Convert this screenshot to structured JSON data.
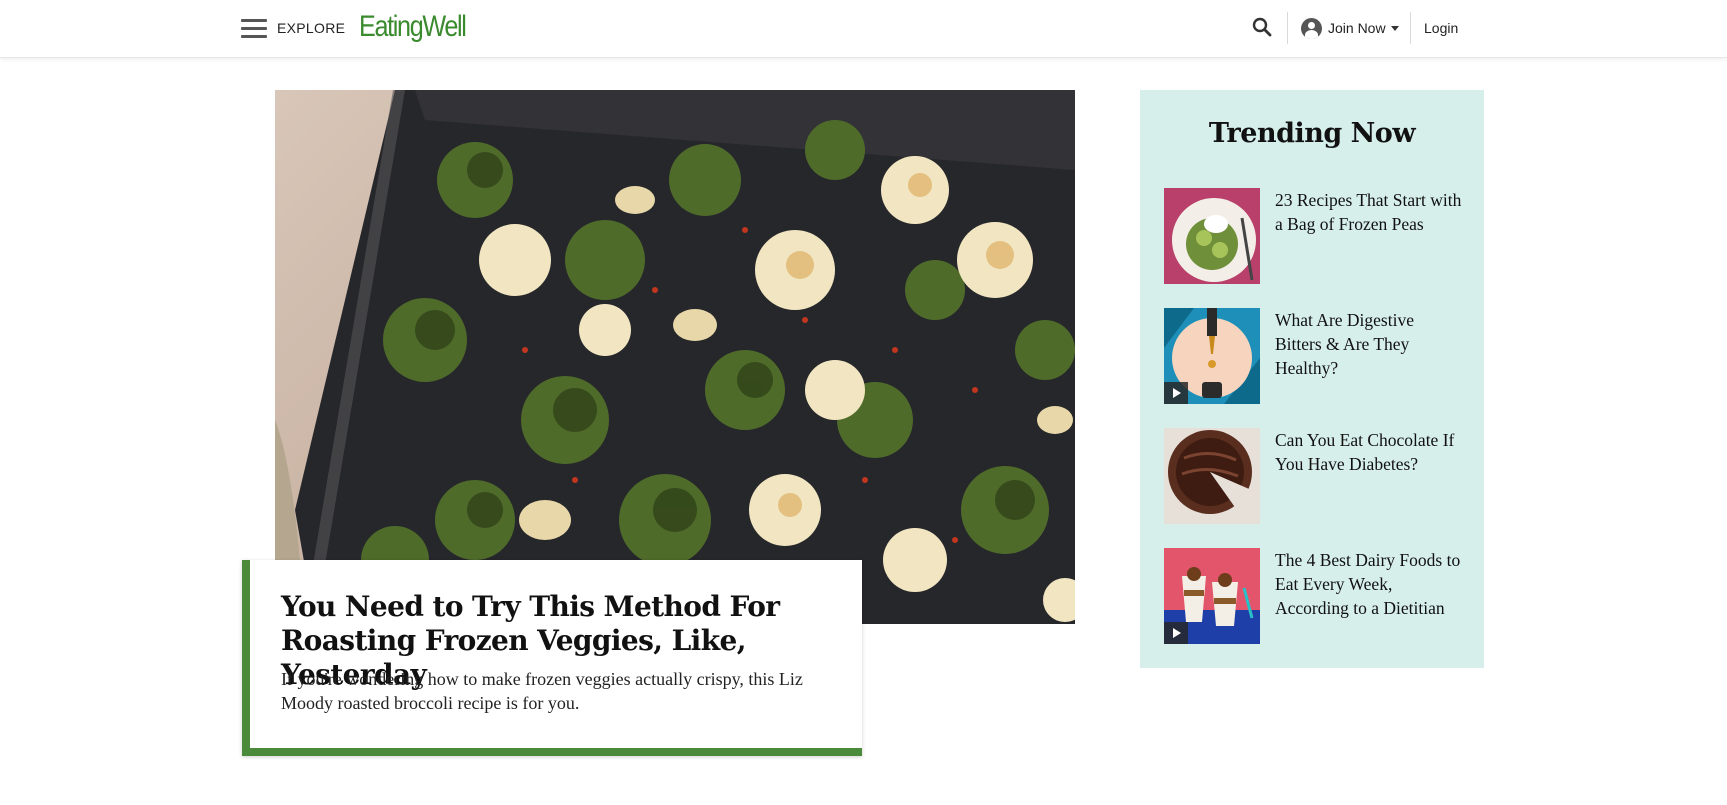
{
  "header": {
    "explore_label": "EXPLORE",
    "logo_text": "EatingWell",
    "join_label": "Join Now",
    "login_label": "Login",
    "icons": [
      "menu-icon",
      "search-icon",
      "account-icon",
      "caret-down-icon"
    ]
  },
  "hero": {
    "title": "You Need to Try This Method For Roasting Frozen Veggies, Like, Yesterday",
    "subtitle": "If you're wondering how to make frozen veggies actually crispy, this Liz Moody roasted broccoli recipe is for you.",
    "accent_color": "#4a8a3a"
  },
  "trending": {
    "title": "Trending Now",
    "background": "#d6efea",
    "items": [
      {
        "label": "23 Recipes That Start with a Bag of Frozen Peas",
        "has_video": false
      },
      {
        "label": "What Are Digestive Bitters & Are They Healthy?",
        "has_video": true
      },
      {
        "label": "Can You Eat Chocolate If You Have Diabetes?",
        "has_video": false
      },
      {
        "label": "The 4 Best Dairy Foods to Eat Every Week, According to a Dietitian",
        "has_video": true
      }
    ]
  },
  "colors": {
    "brand_green": "#3a8a2e"
  }
}
